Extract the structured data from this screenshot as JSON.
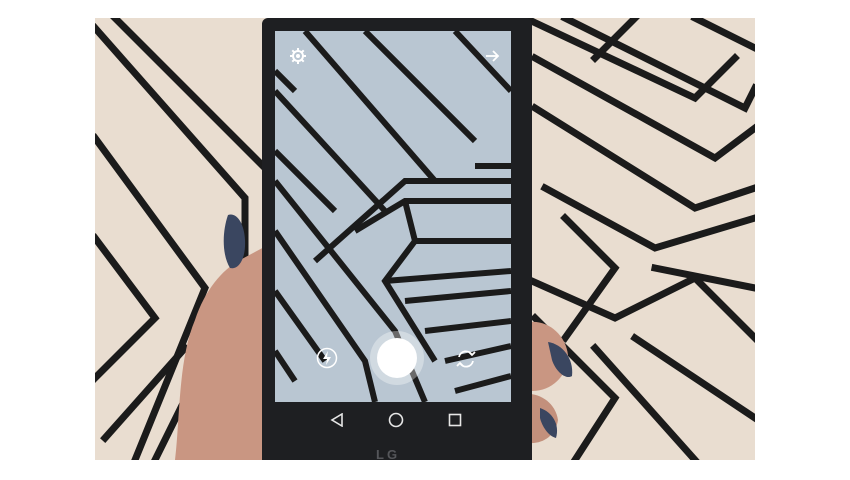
{
  "device": {
    "brand_text": "LG"
  },
  "camera_app": {
    "top_bar": {
      "settings_icon": "gear-icon",
      "next_icon": "arrow-right-icon"
    },
    "controls": {
      "flash_icon": "flash-icon",
      "shutter": "shutter-button",
      "switch_camera_icon": "camera-switch-icon"
    }
  },
  "nav_bar": {
    "back_icon": "back-triangle-icon",
    "home_icon": "home-circle-icon",
    "recents_icon": "recents-square-icon"
  },
  "colors": {
    "wall": "#e9ddd0",
    "stripe": "#1b1b1b",
    "screen_background": "#b9c6d2",
    "phone_body": "#1e1f22"
  }
}
